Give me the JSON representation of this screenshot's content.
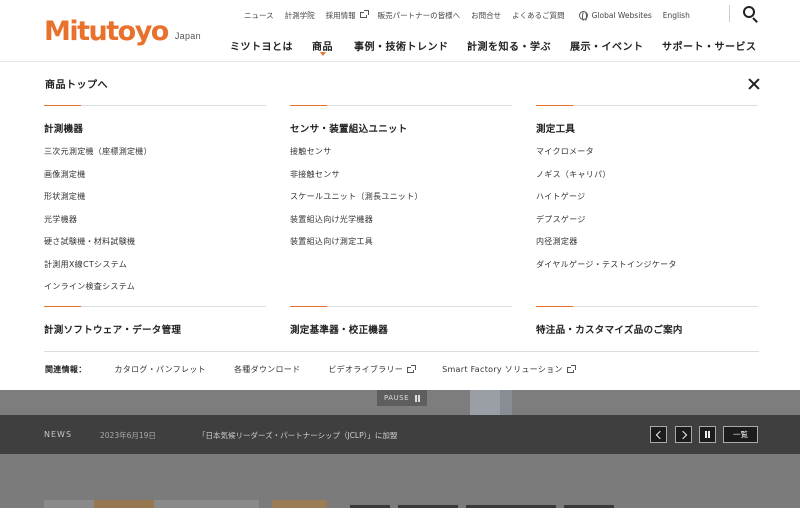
{
  "logo": {
    "brand": "Mitutoyo",
    "region": "Japan"
  },
  "utility_nav": [
    {
      "label": "ニュース",
      "external": false
    },
    {
      "label": "計測学院",
      "external": false
    },
    {
      "label": "採用情報",
      "external": true
    },
    {
      "label": "販売パートナーの皆様へ",
      "external": false
    },
    {
      "label": "お問合せ",
      "external": false
    },
    {
      "label": "よくあるご質問",
      "external": false
    }
  ],
  "global_websites": "Global Websites",
  "language": "English",
  "global_nav": [
    {
      "label": "ミツトヨとは",
      "active": false
    },
    {
      "label": "商品",
      "active": true
    },
    {
      "label": "事例・技術トレンド",
      "active": false
    },
    {
      "label": "計測を知る・学ぶ",
      "active": false
    },
    {
      "label": "展示・イベント",
      "active": false
    },
    {
      "label": "サポート・サービス",
      "active": false
    }
  ],
  "mega_menu": {
    "title": "商品トップへ",
    "columns_top": [
      {
        "title": "計測機器",
        "links": [
          "三次元測定機（座標測定機）",
          "画像測定機",
          "形状測定機",
          "光学機器",
          "硬さ試験機・材料試験機",
          "計測用X線CTシステム",
          "インライン検査システム"
        ]
      },
      {
        "title": "センサ・装置組込ユニット",
        "links": [
          "接触センサ",
          "非接触センサ",
          "スケールユニット（測長ユニット）",
          "装置組込向け光学機器",
          "装置組込向け測定工具"
        ]
      },
      {
        "title": "測定工具",
        "links": [
          "マイクロメータ",
          "ノギス（キャリパ）",
          "ハイトゲージ",
          "デプスゲージ",
          "内径測定器",
          "ダイヤルゲージ・テストインジケータ"
        ]
      }
    ],
    "columns_bottom": [
      {
        "title": "計測ソフトウェア・データ管理"
      },
      {
        "title": "測定基準器・校正機器"
      },
      {
        "title": "特注品・カスタマイズ品のご案内"
      }
    ],
    "related": {
      "label": "関連情報：",
      "links": [
        {
          "label": "カタログ・パンフレット",
          "external": false
        },
        {
          "label": "各種ダウンロード",
          "external": false
        },
        {
          "label": "ビデオライブラリー",
          "external": true
        },
        {
          "label": "Smart Factory ソリューション",
          "external": true
        }
      ]
    }
  },
  "slider": {
    "pause_label": "PAUSE"
  },
  "news": {
    "label": "NEWS",
    "date": "2023年6月19日",
    "headline": "「日本気候リーダーズ・パートナーシップ（JCLP）」に加盟",
    "list_button": "一覧"
  },
  "colors": {
    "brand_orange": "#e8712c",
    "overlay_gray": "#7d7d7d",
    "newsbar": "#3f3f3f"
  }
}
